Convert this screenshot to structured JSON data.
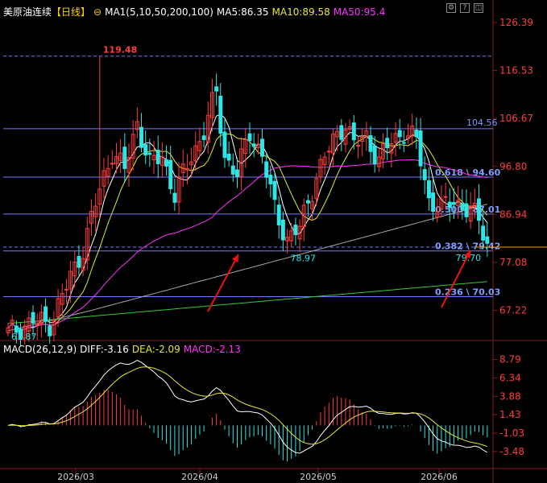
{
  "header": {
    "symbol": "美原油连续",
    "period": "【日线】",
    "ma_label": "MA1(5,10,50,200,100)",
    "ma5": "MA5:86.35",
    "ma10": "MA10:89.58",
    "ma50": "MA50:95.4",
    "colors": {
      "symbol": "#ffffff",
      "period": "#ffcc00",
      "ma5": "#ffffff",
      "ma10": "#e8e830",
      "ma50": "#ff33ff"
    }
  },
  "macd_header": {
    "name": "MACD(26,12,9)",
    "diff": "DIFF:-3.16",
    "dea": "DEA:-2.09",
    "macd": "MACD:-2.13"
  },
  "toolbar": {
    "icons": [
      "settings-icon",
      "help-icon",
      "expand-icon"
    ]
  },
  "chart_data": [
    {
      "type": "candlestick",
      "y_ticks": [
        "126.39",
        "116.53",
        "106.67",
        "96.80",
        "86.94",
        "77.08",
        "67.22"
      ],
      "ylim": [
        61.5,
        126.39
      ],
      "x_ticks": [
        "2026/03",
        "2026/04",
        "2026/05",
        "2026/06"
      ],
      "annotations": {
        "high": "119.48",
        "low": "61.87",
        "swing_low": "78.97",
        "recent_low": "79.70",
        "right_label": "104.56"
      },
      "fib_levels": [
        {
          "label": "0.618 \\ 94.60",
          "value": 94.6
        },
        {
          "label": "0.500 \\ 87.01",
          "value": 87.01
        },
        {
          "label": "0.382 \\ 79.42",
          "value": 79.42
        },
        {
          "label": "0.236 \\ 70.03",
          "value": 70.03
        }
      ],
      "extra_lines": [
        119.48,
        104.56,
        80.2
      ],
      "moving_averages": [
        "MA5",
        "MA10",
        "MA50",
        "MA100",
        "MA200"
      ]
    },
    {
      "type": "macd",
      "y_ticks": [
        "8.79",
        "6.34",
        "3.88",
        "1.43",
        "-1.03",
        "-3.48"
      ],
      "ylim": [
        -5.0,
        9.5
      ],
      "last": {
        "diff": -3.16,
        "dea": -2.09,
        "macd": -2.13
      }
    }
  ]
}
